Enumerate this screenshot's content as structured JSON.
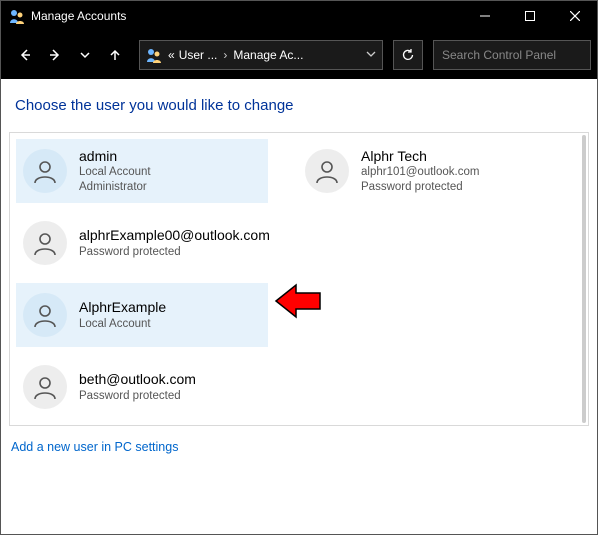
{
  "window": {
    "title": "Manage Accounts"
  },
  "nav": {
    "breadcrumb": {
      "prefix": "«",
      "seg1": "User ...",
      "seg2": "Manage Ac..."
    },
    "search_placeholder": "Search Control Panel"
  },
  "main": {
    "heading": "Choose the user you would like to change",
    "add_link": "Add a new user in PC settings"
  },
  "accounts": [
    {
      "name": "admin",
      "sub1": "Local Account",
      "sub2": "Administrator",
      "selected": true
    },
    {
      "name": "Alphr Tech",
      "sub1": "alphr101@outlook.com",
      "sub2": "Password protected",
      "selected": false
    },
    {
      "name": "alphrExample00@outlook.com",
      "sub1": "Password protected",
      "sub2": "",
      "selected": false
    },
    {
      "name": "AlphrExample",
      "sub1": "Local Account",
      "sub2": "",
      "selected": false,
      "highlighted": true
    },
    {
      "name": "beth@outlook.com",
      "sub1": "Password protected",
      "sub2": "",
      "selected": false
    }
  ]
}
